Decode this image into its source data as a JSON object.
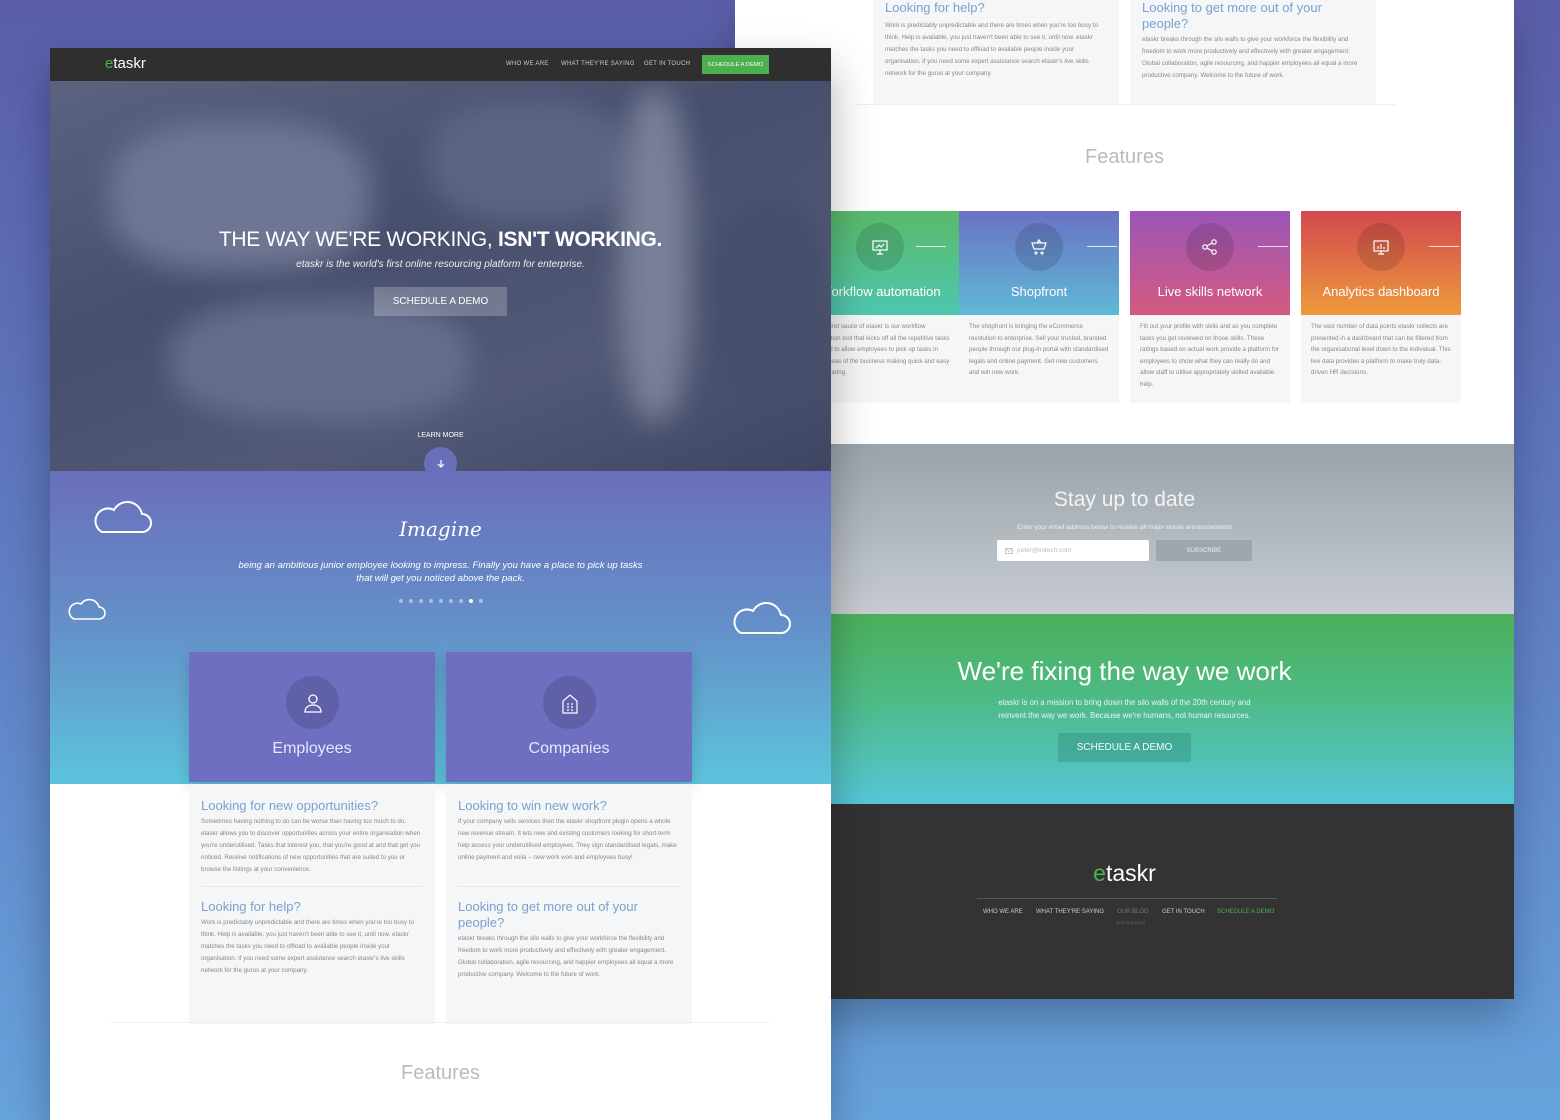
{
  "right": {
    "col1": {
      "title": "Looking for help?",
      "text": "Work is predictably unpredictable and there are times when you're too busy to think. Help is available, you just haven't been able to see it, until now. etaskr matches the tasks you need to offload to available people inside your organisation. If you need some expert assistance search etaskr's live skills network for the gurus at your company."
    },
    "col2": {
      "title": "Looking to get more out of your people?",
      "text": "etaskr breaks through the silo walls to give your workforce the flexibility and freedom to work more productively and effectively with greater engagement. Global collaboration, agile resourcing, and happier employees all equal a more productive company. Welcome to the future of work."
    },
    "features_heading": "Features",
    "features": [
      {
        "name": "Workflow automation",
        "icon": "presentation-icon",
        "desc": "The secret sauce of etaskr is our workflow automation tool that kicks off all the repetitive tasks required to allow employees to pick up tasks in other areas of the business making quick and easy work sharing.",
        "colors": [
          "#58b96a",
          "#4fc7ae"
        ]
      },
      {
        "name": "Shopfront",
        "icon": "cart-icon",
        "desc": "The shopfront is bringing the eCommerce revolution to enterprise. Sell your trusted, branded people through our plug-in portal with standardised legals and online payment. Get new customers and win new work.",
        "colors": [
          "#6a72c4",
          "#5fb9d6"
        ]
      },
      {
        "name": "Live skills network",
        "icon": "share-icon",
        "desc": "Fill out your profile with skills and as you complete tasks you get reviewed on those skills. These ratings based on actual work provide a platform for employees to show what they can really do and allow staff to utilise appropriately skilled available help.",
        "colors": [
          "#9a56b8",
          "#d45a7f"
        ]
      },
      {
        "name": "Analytics dashboard",
        "icon": "chart-icon",
        "desc": "The vast number of data points etaskr collects are presented in a dashboard that can be filtered from the organisational level down to the individual. This live data provides a platform to make truly data-driven HR decisions.",
        "colors": [
          "#d2484f",
          "#ee9a3c"
        ]
      }
    ],
    "newsletter": {
      "title": "Stay up to date",
      "subtitle": "Enter your email address below to receive all major etaskr announcements",
      "placeholder": "peter@initech.com",
      "button": "SUBSCRIBE"
    },
    "mission": {
      "title": "We're fixing the way we work",
      "line1": "etaskr is on a mission to bring down the silo walls of the 20th century and",
      "line2": "reinvent the way we work. Because we're humans, not human resources.",
      "button": "SCHEDULE A DEMO"
    },
    "footer": {
      "logo_e": "e",
      "logo_rest": "taskr",
      "links": [
        "WHO WE ARE",
        "WHAT THEY'RE SAYING",
        "OUR BLOG",
        "GET IN TOUCH",
        "SCHEDULE A DEMO"
      ],
      "coming_soon": "(Coming soon)"
    }
  },
  "left": {
    "logo_e": "e",
    "logo_rest": "taskr",
    "nav": [
      "WHO WE ARE",
      "WHAT THEY'RE SAYING",
      "GET IN TOUCH"
    ],
    "nav_cta": "SCHEDULE A DEMO",
    "hero": {
      "title_light": "THE WAY WE'RE WORKING,",
      "title_bold": "ISN'T WORKING.",
      "subtitle": "etaskr is the world's first online resourcing platform for enterprise.",
      "button": "SCHEDULE A DEMO",
      "learn_more": "LEARN MORE"
    },
    "imagine": {
      "title": "Imagine",
      "line1": "being an ambitious junior employee looking to impress. Finally you have a place to pick up tasks",
      "line2": "that will get you noticed above the pack.",
      "slide_count": 9,
      "active_slide": 8
    },
    "cards": [
      {
        "name": "Employees",
        "icon": "user-icon"
      },
      {
        "name": "Companies",
        "icon": "building-icon"
      }
    ],
    "col1": [
      {
        "title": "Looking for new opportunities?",
        "text": "Sometimes having nothing to do can be worse than having too much to do. etaskr allows you to discover opportunities across your entire organisation when you're underutilised. Tasks that interest you, that you're good at and that get you noticed. Receive notifications of new opportunities that are suited to you or browse the listings at your convenience."
      },
      {
        "title": "Looking for help?",
        "text": "Work is predictably unpredictable and there are times when you're too busy to think. Help is available, you just haven't been able to see it, until now. etaskr matches the tasks you need to offload to available people inside your organisation. If you need some expert assistance search etaskr's live skills network for the gurus at your company."
      }
    ],
    "col2": [
      {
        "title": "Looking to win new work?",
        "text": "If your company sells services then the etaskr shopfront plugin opens a whole new revenue stream. It lets new and existing customers looking for short-term help access your underutilised employees. They sign standardised legals, make online payment and voila – new work won and employees busy!"
      },
      {
        "title": "Looking to get more out of your people?",
        "text": "etaskr breaks through the silo walls to give your workforce the flexibility and freedom to work more productively and effectively with greater engagement. Global collaboration, agile resourcing, and happier employees all equal a more productive company. Welcome to the future of work."
      }
    ],
    "features_heading": "Features"
  },
  "colors": {
    "accent_green": "#4caf50",
    "card_purple": "#6e6fc0",
    "footer_dark": "#2f2f2f"
  }
}
